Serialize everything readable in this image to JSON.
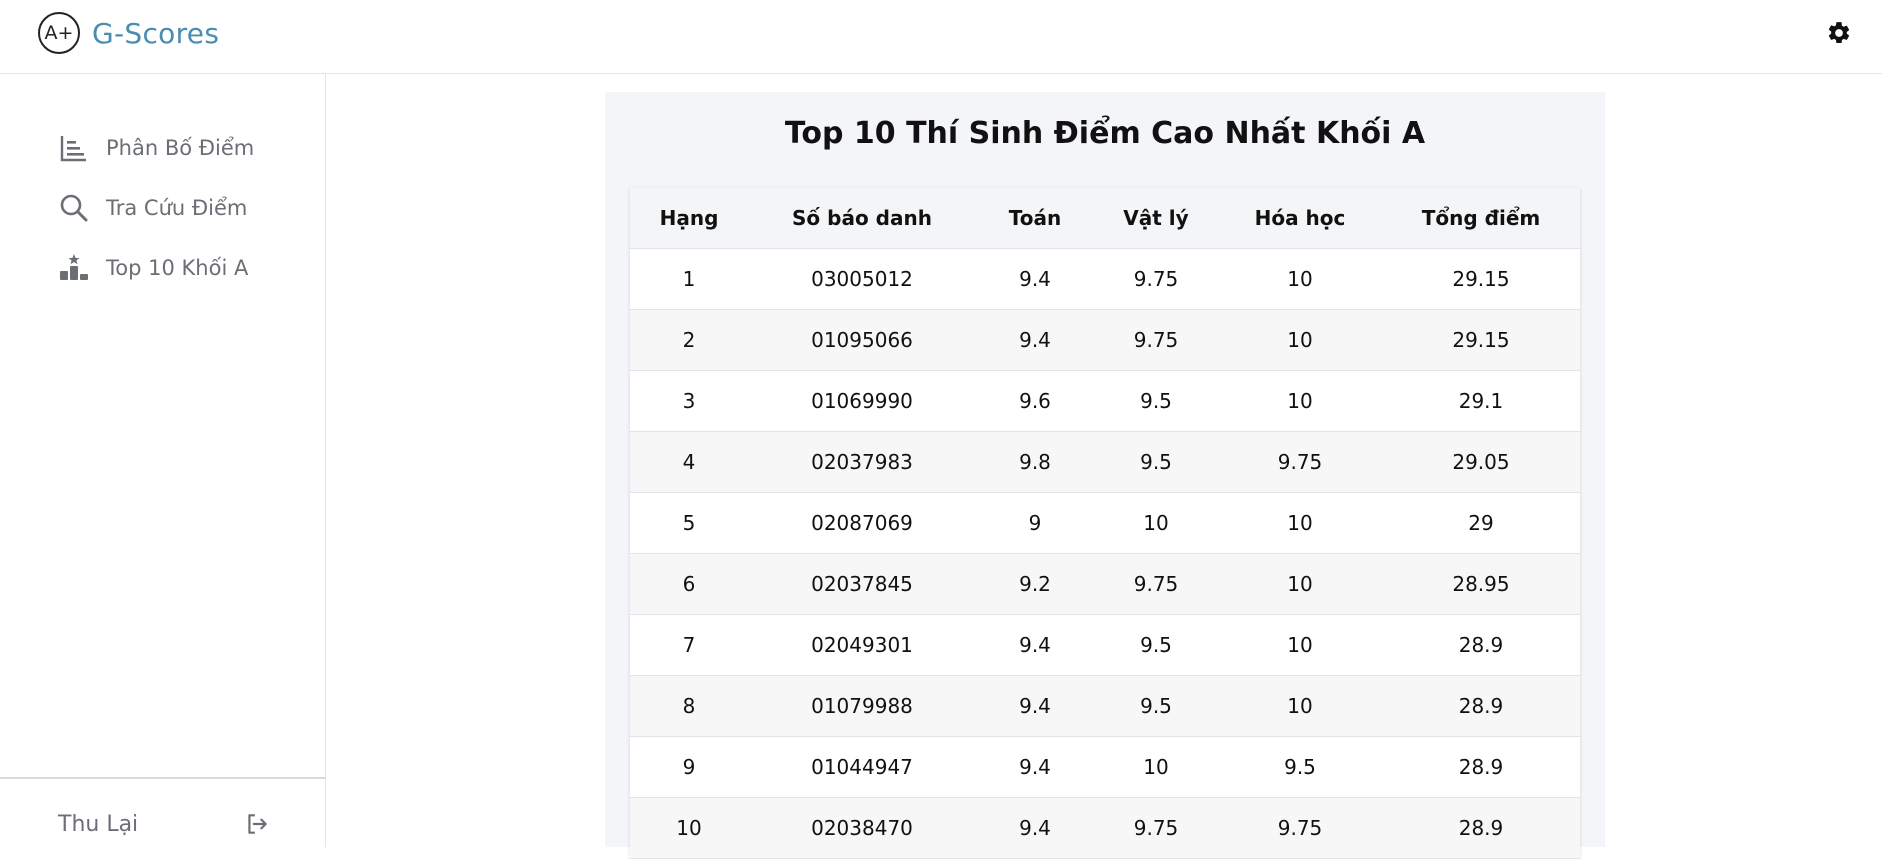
{
  "app": {
    "logo_mark": "A+",
    "name": "G-Scores"
  },
  "sidebar": {
    "items": [
      {
        "label": "Phân Bố Điểm",
        "icon": "bar-chart-icon"
      },
      {
        "label": "Tra Cứu Điểm",
        "icon": "search-icon"
      },
      {
        "label": "Top 10 Khối A",
        "icon": "podium-icon"
      }
    ],
    "footer": {
      "label": "Thu Lại",
      "icon": "logout-icon"
    }
  },
  "main": {
    "title": "Top 10 Thí Sinh Điểm Cao Nhất Khối A",
    "table": {
      "headers": [
        "Hạng",
        "Số báo danh",
        "Toán",
        "Vật lý",
        "Hóa học",
        "Tổng điểm"
      ],
      "rows": [
        [
          "1",
          "03005012",
          "9.4",
          "9.75",
          "10",
          "29.15"
        ],
        [
          "2",
          "01095066",
          "9.4",
          "9.75",
          "10",
          "29.15"
        ],
        [
          "3",
          "01069990",
          "9.6",
          "9.5",
          "10",
          "29.1"
        ],
        [
          "4",
          "02037983",
          "9.8",
          "9.5",
          "9.75",
          "29.05"
        ],
        [
          "5",
          "02087069",
          "9",
          "10",
          "10",
          "29"
        ],
        [
          "6",
          "02037845",
          "9.2",
          "9.75",
          "10",
          "28.95"
        ],
        [
          "7",
          "02049301",
          "9.4",
          "9.5",
          "10",
          "28.9"
        ],
        [
          "8",
          "01079988",
          "9.4",
          "9.5",
          "10",
          "28.9"
        ],
        [
          "9",
          "01044947",
          "9.4",
          "10",
          "9.5",
          "28.9"
        ],
        [
          "10",
          "02038470",
          "9.4",
          "9.75",
          "9.75",
          "28.9"
        ]
      ]
    }
  },
  "colors": {
    "brand": "#4a8db0",
    "nav_text": "#6b6f75",
    "card_bg": "#f3f5f8"
  }
}
